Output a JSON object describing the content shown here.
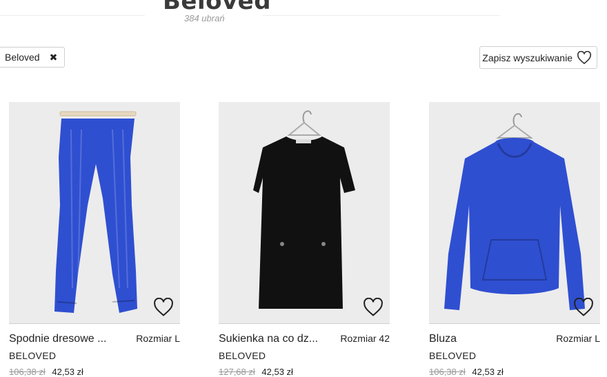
{
  "header": {
    "brand_title": "Beloved",
    "item_count": "384 ubrań"
  },
  "filters": {
    "chips": [
      {
        "label": "Beloved",
        "remove_icon": "close-icon"
      }
    ],
    "save_search_label": "Zapisz wyszukiwanie",
    "save_search_icon": "heart-icon"
  },
  "products": [
    {
      "title": "Spodnie dresowe ...",
      "size": "Rozmiar L",
      "brand": "BELOVED",
      "old_price": "106,38 zł",
      "price": "42,53 zł",
      "color": "#2f4fd1"
    },
    {
      "title": "Sukienka na co dz...",
      "size": "Rozmiar 42",
      "brand": "BELOVED",
      "old_price": "127,68 zł",
      "price": "42,53 zł",
      "color": "#111111"
    },
    {
      "title": "Bluza",
      "size": "Rozmiar L",
      "brand": "BELOVED",
      "old_price": "106,38 zł",
      "price": "42,53 zł",
      "color": "#2f4fd1"
    }
  ]
}
